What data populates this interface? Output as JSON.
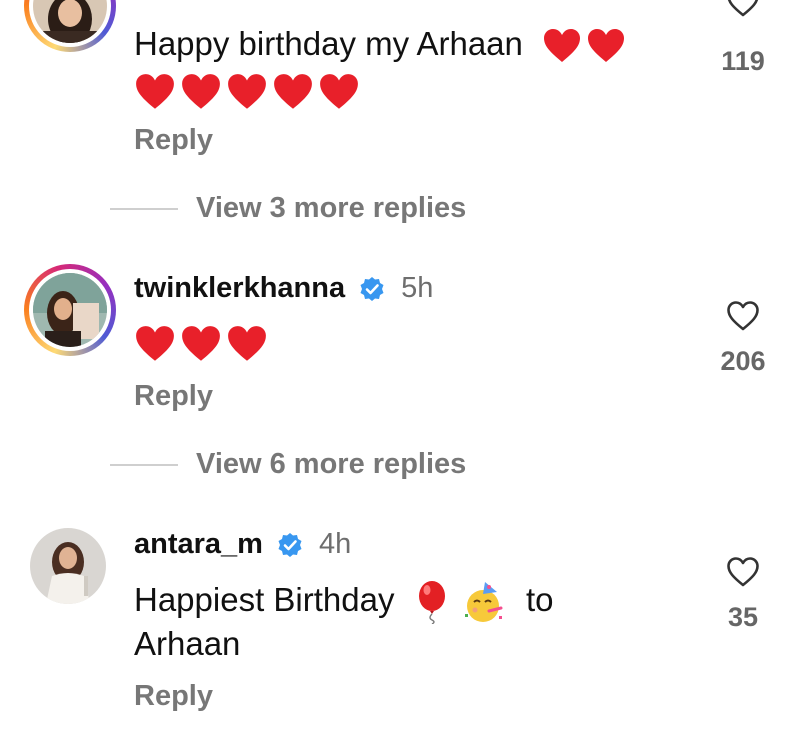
{
  "comments": [
    {
      "username": "",
      "time": "",
      "text": "Happy birthday my Arhaan",
      "likes": "119",
      "reply_label": "Reply",
      "avatar_icon": "woman-avatar-photo"
    },
    {
      "username": "twinklerkhanna",
      "time": "5h",
      "text": "",
      "likes": "206",
      "reply_label": "Reply",
      "avatar_icon": "woman-with-book-avatar-photo"
    },
    {
      "username": "antara_m",
      "time": "4h",
      "text_line1": "Happiest Birthday",
      "text_to": "to",
      "text_line2": "Arhaan",
      "likes": "35",
      "reply_label": "Reply",
      "avatar_icon": "woman-in-white-avatar-photo"
    }
  ],
  "view_replies": [
    {
      "label": "View 3 more replies"
    },
    {
      "label": "View 6 more replies"
    }
  ],
  "icons": {
    "heart": "heart-outline-icon",
    "verified": "verified-badge-icon",
    "red_heart_emoji": "red-heart-emoji",
    "balloon_emoji": "balloon-emoji",
    "party_face_emoji": "partying-face-emoji"
  },
  "colors": {
    "verified_blue": "#3897f0",
    "heart_red": "#e8202a",
    "muted_text": "#777777"
  }
}
